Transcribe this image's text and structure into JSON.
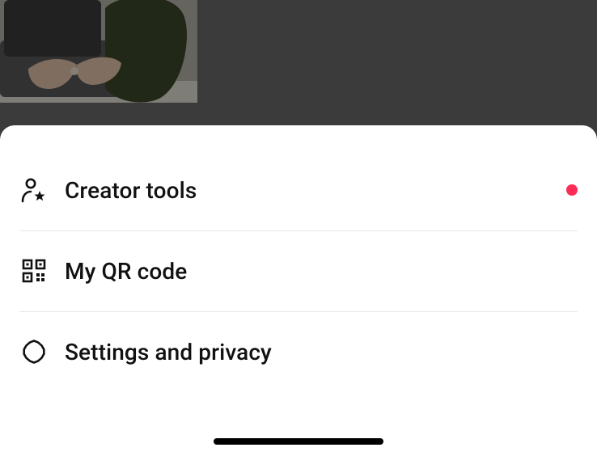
{
  "menu": {
    "items": [
      {
        "label": "Creator tools",
        "has_notification": true
      },
      {
        "label": "My QR code",
        "has_notification": false
      },
      {
        "label": "Settings and privacy",
        "has_notification": false
      }
    ]
  }
}
